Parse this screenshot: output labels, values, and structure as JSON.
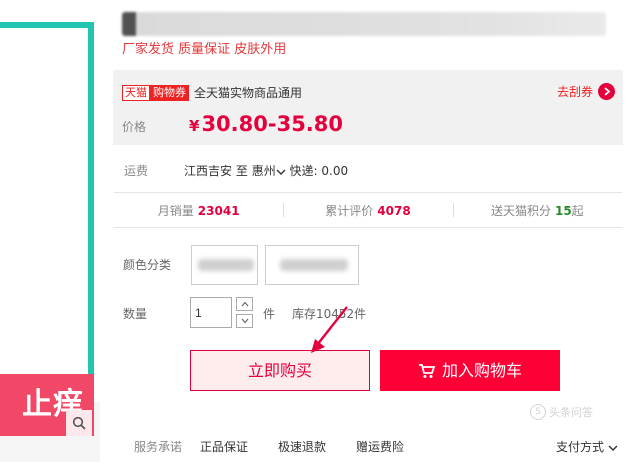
{
  "left_image": {
    "promo_text": "止痒"
  },
  "subtitle": "厂家发货 质量保证 皮肤外用",
  "coupon": {
    "tag_tmall": "天猫",
    "tag_coupon": "购物券",
    "text": "全天猫实物商品通用",
    "get_label": "去刮券"
  },
  "price": {
    "label": "价格",
    "currency": "¥",
    "value": "30.80-35.80"
  },
  "shipping": {
    "label": "运费",
    "from": "江西吉安",
    "to_word": "至",
    "to_city": "惠州",
    "method": "快递: 0.00"
  },
  "stats": [
    {
      "label": "月销量",
      "value": "23041",
      "style": "red"
    },
    {
      "label": "累计评价",
      "value": "4078",
      "style": "red"
    },
    {
      "label": "送天猫积分",
      "value": "15",
      "suffix": "起",
      "style": "green"
    }
  ],
  "color": {
    "label": "颜色分类"
  },
  "quantity": {
    "label": "数量",
    "value": "1",
    "unit": "件",
    "stock": "库存10452件"
  },
  "buttons": {
    "buy": "立即购买",
    "add_cart": "加入购物车"
  },
  "services": {
    "label": "服务承诺",
    "items": [
      "正品保证",
      "极速退款",
      "赠运费险"
    ]
  },
  "payment": {
    "label": "支付方式"
  },
  "watermark": "头条问答",
  "colors": {
    "accent": "#e4003d",
    "teal": "#23c4b0",
    "promo": "#f04866"
  }
}
